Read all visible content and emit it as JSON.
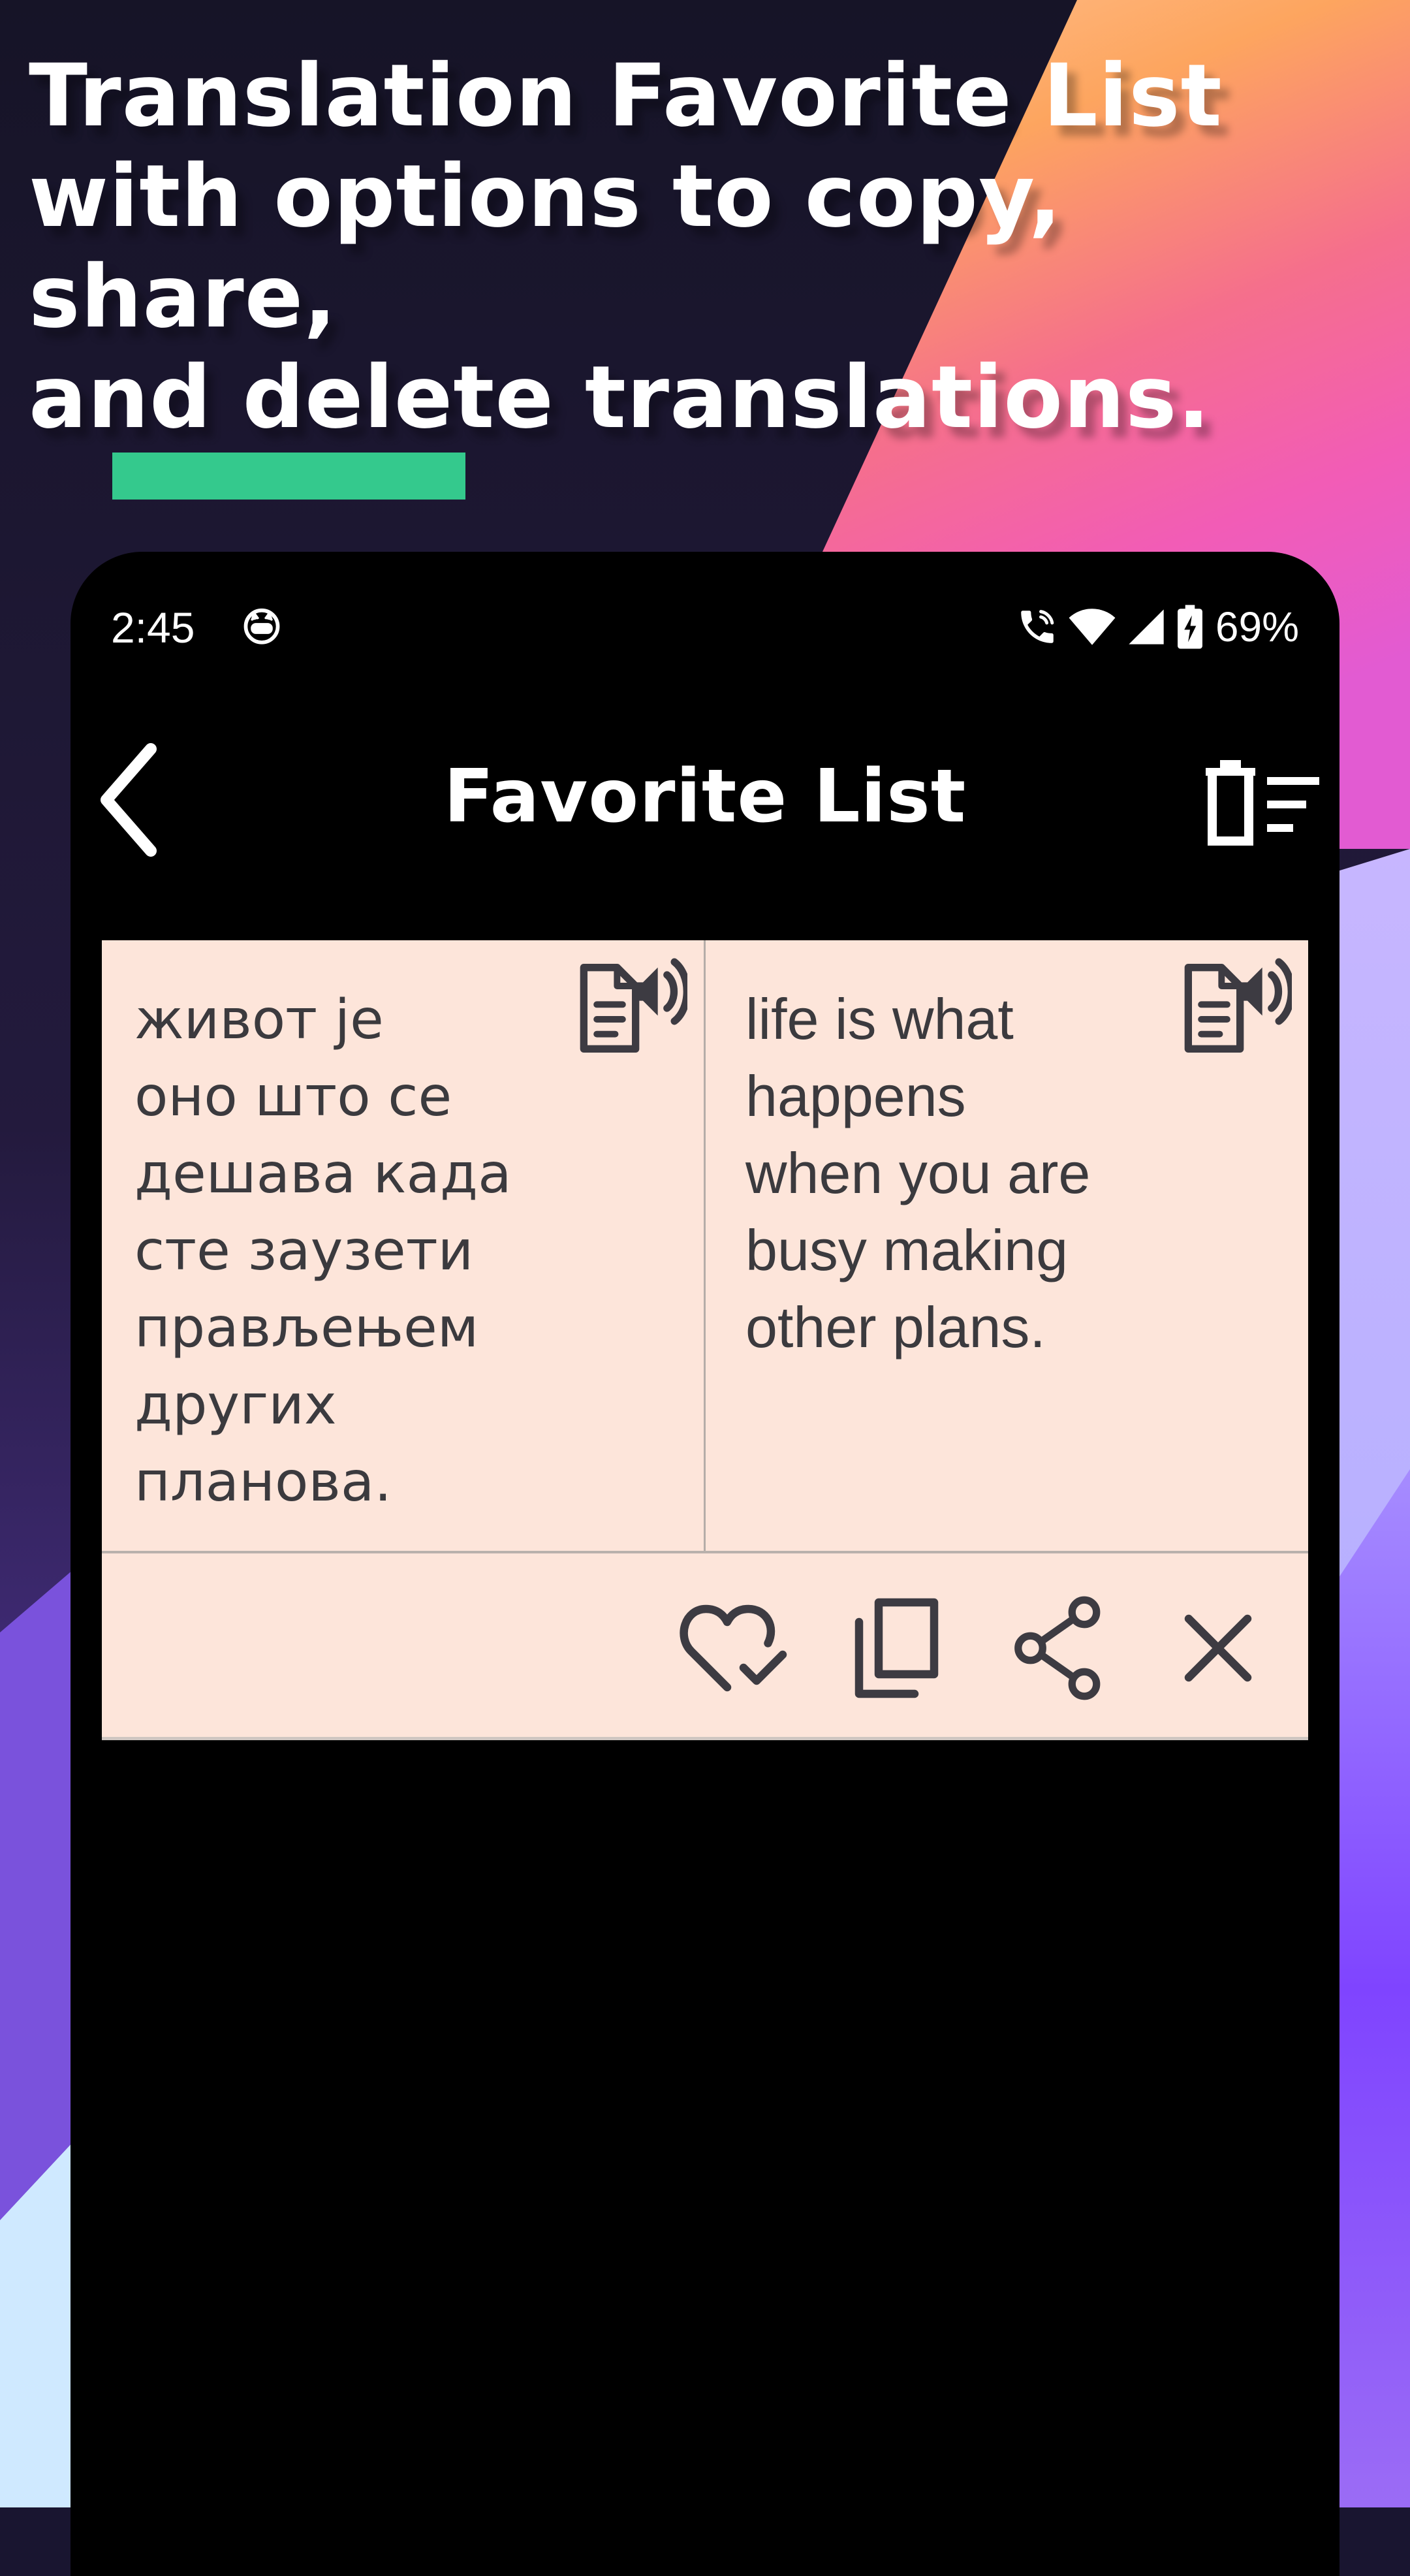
{
  "promo": {
    "headline": "Translation Favorite List\nwith options to copy, share,\nand delete translations.",
    "colors": {
      "background_dark": "#191530",
      "orange": "#fda55f",
      "pink": "#f25cb6",
      "purple": "#8a57f2",
      "accent_bar": "#34c98d"
    }
  },
  "status_bar": {
    "time": "2:45",
    "notification_icon": "cat-face-icon",
    "icons": [
      "wifi-calling-icon",
      "wifi-icon",
      "signal-icon",
      "battery-charging-icon"
    ],
    "battery": "69%"
  },
  "app_bar": {
    "title": "Favorite List",
    "back_icon": "chevron-left-icon",
    "clear_icon": "delete-all-icon"
  },
  "favorites": [
    {
      "source_text": "живот је\nоно што се\nдешава када\nсте заузети\nправљењем\nдругих\nпланова.",
      "translated_text": "life is what\nhappens\nwhen you are\nbusy making\nother plans.",
      "card_color": "#fde5da",
      "speak_icon": "text-to-speech-icon",
      "actions": [
        "favorite-check-icon",
        "copy-icon",
        "share-icon",
        "close-icon"
      ]
    }
  ]
}
